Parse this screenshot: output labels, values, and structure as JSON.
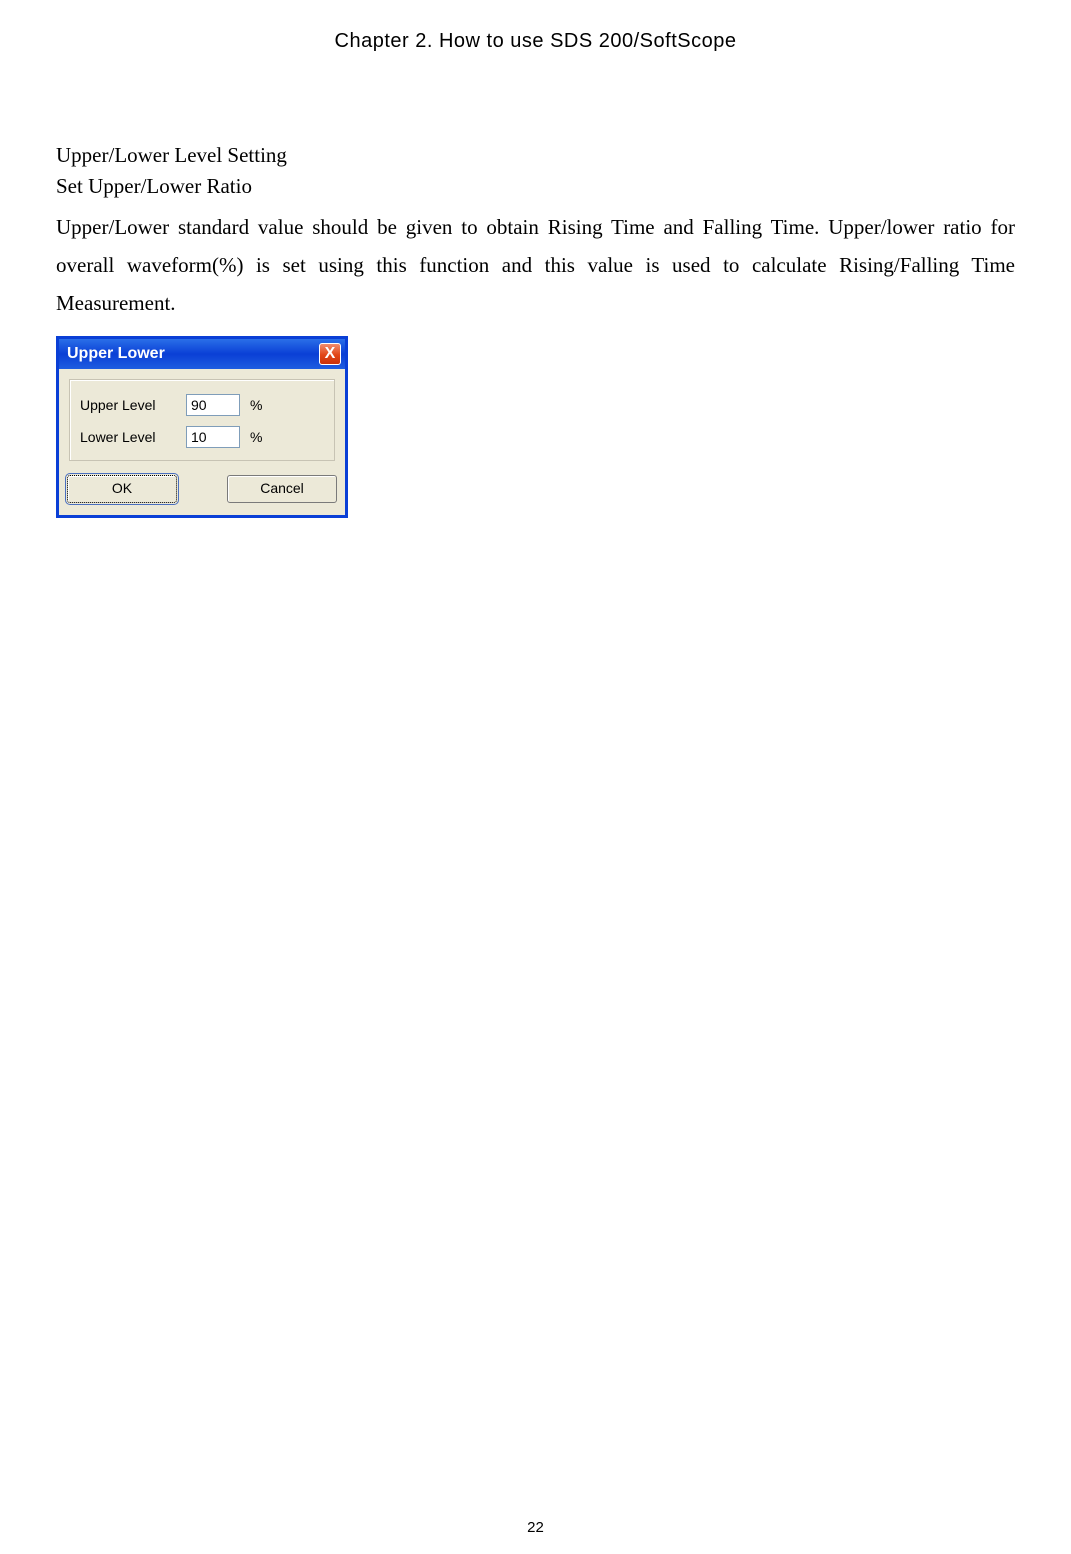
{
  "chapter": {
    "title": "Chapter 2. How to use SDS 200/SoftScope"
  },
  "doc": {
    "heading": "Upper/Lower Level Setting",
    "subheading": "Set Upper/Lower Ratio",
    "body": "Upper/Lower standard value should be given to obtain Rising Time and Falling Time. Upper/lower ratio for overall waveform(%) is set using this function and this value is used to calculate Rising/Falling Time Measurement."
  },
  "dialog": {
    "title": "Upper Lower",
    "close_glyph": "X",
    "rows": {
      "upper": {
        "label": "Upper Level",
        "value": "90",
        "unit": "%"
      },
      "lower": {
        "label": "Lower Level",
        "value": "10",
        "unit": "%"
      }
    },
    "buttons": {
      "ok": "OK",
      "cancel": "Cancel"
    }
  },
  "page_number": "22"
}
